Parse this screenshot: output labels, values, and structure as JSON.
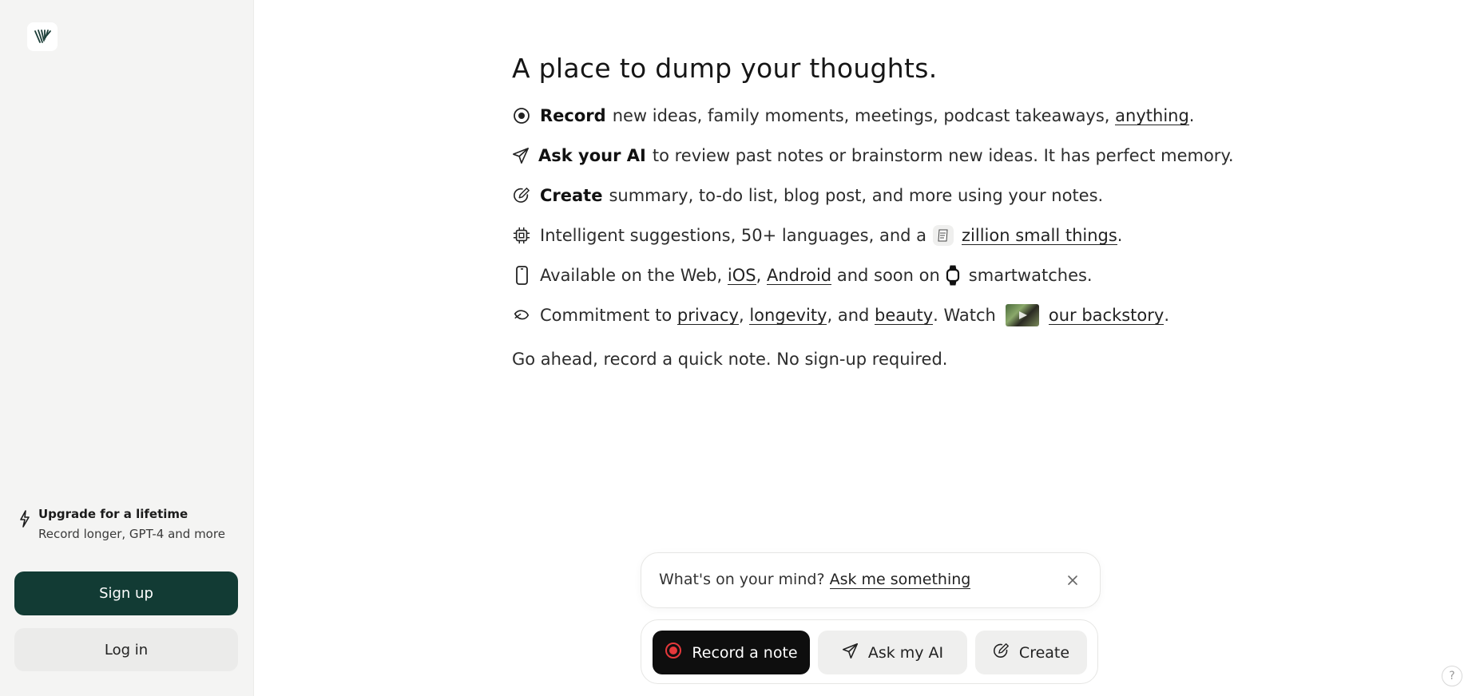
{
  "sidebar": {
    "logo_icon": "logo-icon",
    "upgrade": {
      "title": "Upgrade for a lifetime",
      "subtitle": "Record longer, GPT-4 and more",
      "icon": "bolt-icon"
    },
    "signup_label": "Sign up",
    "login_label": "Log in"
  },
  "main": {
    "headline": "A place to dump your thoughts.",
    "features": {
      "record": {
        "icon": "record-icon",
        "bold": "Record",
        "text": "new ideas, family moments, meetings, podcast takeaways,",
        "link": "anything",
        "end": "."
      },
      "ask": {
        "icon": "send-icon",
        "bold": "Ask your AI",
        "text": "to review past notes or brainstorm new ideas. It has perfect memory."
      },
      "create": {
        "icon": "create-icon",
        "bold": "Create",
        "text": "summary, to-do list, blog post, and more using your notes."
      },
      "intelligent": {
        "icon": "chip-icon",
        "text": "Intelligent suggestions, 50+ languages, and a",
        "link": "zillion small things",
        "end": "."
      },
      "available": {
        "icon": "phone-icon",
        "text": "Available on the Web,",
        "link1": "iOS",
        "sep": ",",
        "link2": "Android",
        "text2": "and soon on",
        "text3": "smartwatches."
      },
      "commitment": {
        "icon": "leaf-icon",
        "text": "Commitment to",
        "link1": "privacy",
        "sep1": ",",
        "link2": "longevity",
        "sep2": ", and",
        "link3": "beauty",
        "text2": ". Watch",
        "link4": "our backstory",
        "end": "."
      }
    },
    "go_ahead": "Go ahead, record a quick note. No sign-up required."
  },
  "ask_box": {
    "prompt": "What's on your mind?",
    "link": "Ask me something"
  },
  "actions": {
    "record": "Record a note",
    "ask": "Ask my AI",
    "create": "Create"
  },
  "help": "?",
  "colors": {
    "brand_dark_green": "#123b34",
    "record_red": "#e5383b",
    "sidebar_bg": "#f4f4f3"
  }
}
